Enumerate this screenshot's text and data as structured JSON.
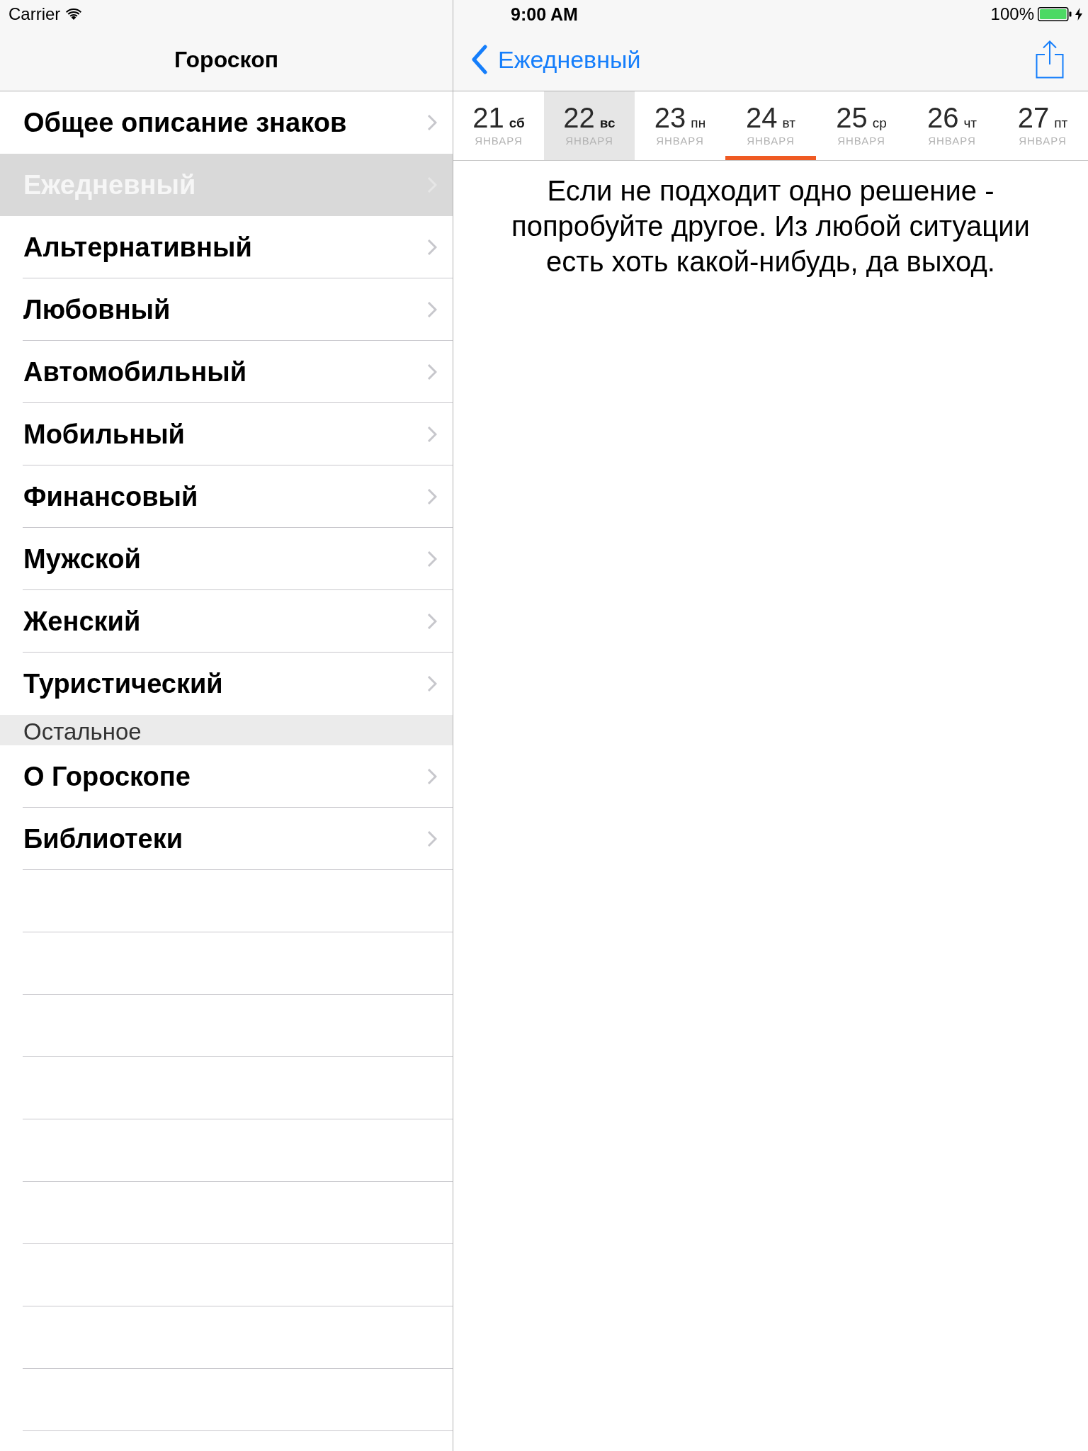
{
  "status_bar": {
    "carrier": "Carrier",
    "time": "9:00 AM",
    "battery": "100%"
  },
  "sidebar": {
    "title": "Гороскоп",
    "sections": [
      {
        "items": [
          {
            "label": "Общее описание знаков",
            "selected": false
          },
          {
            "label": "Ежедневный",
            "selected": true
          },
          {
            "label": "Альтернативный",
            "selected": false
          },
          {
            "label": "Любовный",
            "selected": false
          },
          {
            "label": "Автомобильный",
            "selected": false
          },
          {
            "label": "Мобильный",
            "selected": false
          },
          {
            "label": "Финансовый",
            "selected": false
          },
          {
            "label": "Мужской",
            "selected": false
          },
          {
            "label": "Женский",
            "selected": false
          },
          {
            "label": "Туристический",
            "selected": false
          }
        ]
      },
      {
        "header": "Остальное",
        "items": [
          {
            "label": "О Гороскопе",
            "selected": false
          },
          {
            "label": "Библиотеки",
            "selected": false
          }
        ]
      }
    ]
  },
  "detail": {
    "back_button": "Ежедневный",
    "days": [
      {
        "day": "21",
        "weekday": "сб",
        "month": "ЯНВАРЯ",
        "weekend": true,
        "highlighted": false,
        "selected": false
      },
      {
        "day": "22",
        "weekday": "вс",
        "month": "ЯНВАРЯ",
        "weekend": true,
        "highlighted": true,
        "selected": false
      },
      {
        "day": "23",
        "weekday": "пн",
        "month": "ЯНВАРЯ",
        "weekend": false,
        "highlighted": false,
        "selected": false
      },
      {
        "day": "24",
        "weekday": "вт",
        "month": "ЯНВАРЯ",
        "weekend": false,
        "highlighted": false,
        "selected": true
      },
      {
        "day": "25",
        "weekday": "ср",
        "month": "ЯНВАРЯ",
        "weekend": false,
        "highlighted": false,
        "selected": false
      },
      {
        "day": "26",
        "weekday": "чт",
        "month": "ЯНВАРЯ",
        "weekend": false,
        "highlighted": false,
        "selected": false
      },
      {
        "day": "27",
        "weekday": "пт",
        "month": "ЯНВАРЯ",
        "weekend": false,
        "highlighted": false,
        "selected": false
      }
    ],
    "text": "Если не подходит одно решение - попробуйте другое. Из любой ситуации есть хоть какой-нибудь, да выход."
  }
}
